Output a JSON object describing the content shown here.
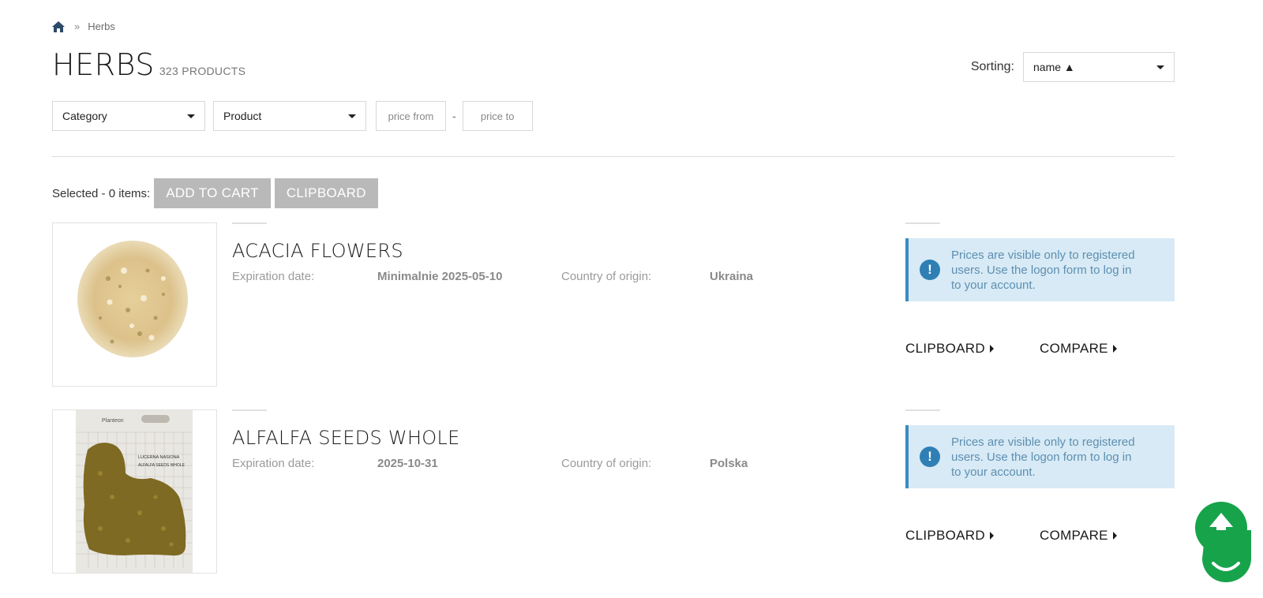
{
  "breadcrumb": {
    "home_icon": "home-icon",
    "separator": "»",
    "current": "Herbs"
  },
  "header": {
    "title": "HERBS",
    "product_count": "323 PRODUCTS"
  },
  "sorting": {
    "label": "Sorting:",
    "selected": "name ▲"
  },
  "filters": {
    "category": "Category",
    "product": "Product",
    "price_from_placeholder": "price from",
    "price_separator": "-",
    "price_to_placeholder": "price to"
  },
  "selection": {
    "text": "Selected - 0 items:",
    "add_to_cart": "ADD TO CART",
    "clipboard": "CLIPBOARD"
  },
  "products": [
    {
      "name": "ACACIA FLOWERS",
      "expiration_label": "Expiration date:",
      "expiration_value": "Minimalnie 2025-05-10",
      "origin_label": "Country of origin:",
      "origin_value": "Ukraina",
      "price_notice": "Prices are visible only to registered users. Use the logon form to log in to your account.",
      "clipboard_label": "CLIPBOARD",
      "compare_label": "COMPARE"
    },
    {
      "name": "ALFALFA SEEDS WHOLE",
      "expiration_label": "Expiration date:",
      "expiration_value": "2025-10-31",
      "origin_label": "Country of origin:",
      "origin_value": "Polska",
      "price_notice": "Prices are visible only to registered users. Use the logon form to log in to your account.",
      "clipboard_label": "CLIPBOARD",
      "compare_label": "COMPARE",
      "image_text": {
        "brand": "Planteon",
        "label_line1": "LUCERNA NASIONA",
        "label_line2": "ALFALFA SEEDS WHOLE"
      }
    }
  ],
  "colors": {
    "accent_green": "#17a34a",
    "notice_bg": "#d7eaf5",
    "notice_border": "#3d8bc0",
    "button_gray": "#b9b9b9"
  },
  "floating": {
    "scroll_top_icon": "arrow-up-icon",
    "chat_icon": "chat-bubble-icon"
  }
}
